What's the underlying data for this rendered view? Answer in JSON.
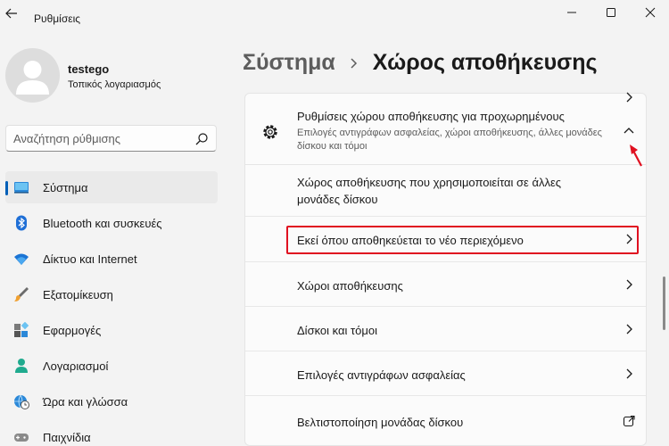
{
  "window": {
    "title": "Ρυθμίσεις"
  },
  "profile": {
    "name": "testego",
    "type": "Τοπικός λογαριασμός"
  },
  "search": {
    "placeholder": "Αναζήτηση ρύθμισης"
  },
  "sidebar": {
    "items": [
      {
        "label": "Σύστημα",
        "icon": "system-icon",
        "active": true
      },
      {
        "label": "Bluetooth και συσκευές",
        "icon": "bluetooth-icon"
      },
      {
        "label": "Δίκτυο και Internet",
        "icon": "wifi-icon"
      },
      {
        "label": "Εξατομίκευση",
        "icon": "brush-icon"
      },
      {
        "label": "Εφαρμογές",
        "icon": "apps-icon"
      },
      {
        "label": "Λογαριασμοί",
        "icon": "person-icon"
      },
      {
        "label": "Ώρα και γλώσσα",
        "icon": "globe-clock-icon"
      },
      {
        "label": "Παιχνίδια",
        "icon": "gamepad-icon"
      }
    ]
  },
  "breadcrumb": {
    "parent": "Σύστημα",
    "current": "Χώρος αποθήκευσης"
  },
  "panel": {
    "header": {
      "title": "Ρυθμίσεις χώρου αποθήκευσης για προχωρημένους",
      "subtitle": "Επιλογές αντιγράφων ασφαλείας, χώροι αποθήκευσης, άλλες μονάδες δίσκου και τόμοι"
    },
    "rows": [
      {
        "label": "Χώρος αποθήκευσης που χρησιμοποιείται σε άλλες μονάδες δίσκου",
        "icon": "chevron-right-icon"
      },
      {
        "label": "Εκεί όπου αποθηκεύεται το νέο περιεχόμενο",
        "icon": "chevron-right-icon",
        "highlighted": true
      },
      {
        "label": "Χώροι αποθήκευσης",
        "icon": "chevron-right-icon"
      },
      {
        "label": "Δίσκοι και τόμοι",
        "icon": "chevron-right-icon"
      },
      {
        "label": "Επιλογές αντιγράφων ασφαλείας",
        "icon": "chevron-right-icon"
      },
      {
        "label": "Βελτιστοποίηση μονάδας δίσκου",
        "icon": "open-external-icon"
      }
    ]
  },
  "colors": {
    "accent": "#005fb8",
    "highlight": "#e01020",
    "background": "#f3f3f3"
  }
}
